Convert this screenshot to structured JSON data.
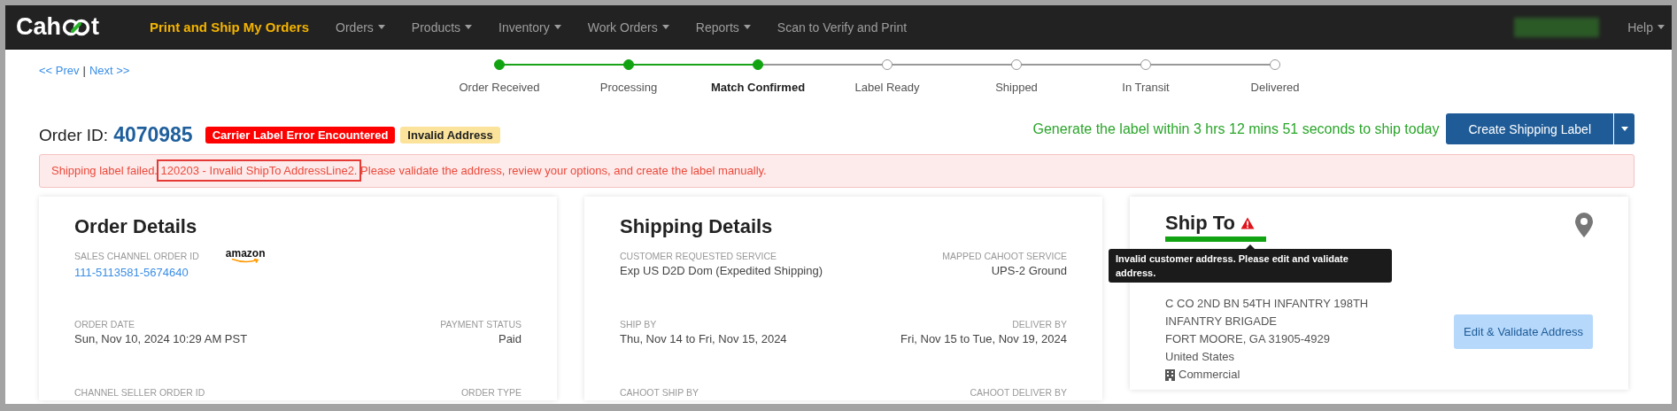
{
  "nav": {
    "logo": [
      "Cah",
      "t"
    ],
    "items": [
      {
        "label": "Print and Ship My Orders",
        "selected": true,
        "dropdown": false
      },
      {
        "label": "Orders",
        "selected": false,
        "dropdown": true
      },
      {
        "label": "Products",
        "selected": false,
        "dropdown": true
      },
      {
        "label": "Inventory",
        "selected": false,
        "dropdown": true
      },
      {
        "label": "Work Orders",
        "selected": false,
        "dropdown": true
      },
      {
        "label": "Reports",
        "selected": false,
        "dropdown": true
      },
      {
        "label": "Scan to Verify and Print",
        "selected": false,
        "dropdown": false
      }
    ],
    "help": {
      "label": "Help",
      "dropdown": true
    }
  },
  "pager": {
    "prev": "<< Prev",
    "separator": "|",
    "next": "Next >>"
  },
  "steps": [
    {
      "label": "Order Received",
      "done": true,
      "current": false
    },
    {
      "label": "Processing",
      "done": true,
      "current": false
    },
    {
      "label": "Match Confirmed",
      "done": true,
      "current": true
    },
    {
      "label": "Label Ready",
      "done": false,
      "current": false
    },
    {
      "label": "Shipped",
      "done": false,
      "current": false
    },
    {
      "label": "In Transit",
      "done": false,
      "current": false
    },
    {
      "label": "Delivered",
      "done": false,
      "current": false
    }
  ],
  "order": {
    "label": "Order ID:",
    "id": "4070985",
    "badges": [
      {
        "text": "Carrier Label Error Encountered",
        "kind": "error"
      },
      {
        "text": "Invalid Address",
        "kind": "warning"
      }
    ]
  },
  "ship_notice": "Generate the label within 3 hrs 12 mins 51 seconds to ship today",
  "create_button": {
    "label": "Create Shipping Label",
    "dropdown": true
  },
  "alert": {
    "before": "Shipping label failed.",
    "highlight": "120203 - Invalid ShipTo AddressLine2.",
    "after": "Please validate the address, review your options, and create the label manually."
  },
  "cards": [
    {
      "title": "Order Details",
      "rows": [
        {
          "left": {
            "label": "SALES CHANNEL ORDER ID",
            "value": "111-5113581-5674640",
            "link": true,
            "logo": "amazon"
          }
        },
        {
          "left": {
            "label": "ORDER DATE",
            "value": "Sun, Nov 10, 2024 10:29 AM PST"
          },
          "right": {
            "label": "PAYMENT STATUS",
            "value": "Paid"
          }
        },
        {
          "left": {
            "label": "CHANNEL SELLER ORDER ID"
          },
          "right": {
            "label": "ORDER TYPE"
          }
        }
      ]
    },
    {
      "title": "Shipping Details",
      "rows": [
        {
          "left": {
            "label": "CUSTOMER REQUESTED SERVICE",
            "value": "Exp US D2D Dom (Expedited Shipping)"
          },
          "right": {
            "label": "MAPPED CAHOOT SERVICE",
            "value": "UPS-2 Ground"
          }
        },
        {
          "left": {
            "label": "SHIP BY",
            "value": "Thu, Nov 14 to Fri, Nov 15, 2024"
          },
          "right": {
            "label": "DELIVER BY",
            "value": "Fri, Nov 15 to Tue, Nov 19, 2024"
          }
        },
        {
          "left": {
            "label": "CAHOOT SHIP BY"
          },
          "right": {
            "label": "CAHOOT DELIVER BY"
          }
        }
      ]
    }
  ],
  "ship_to": {
    "title": "Ship To",
    "warning": true,
    "tooltip": "Invalid customer address. Please edit and validate address.",
    "lines": [
      "C CO 2ND BN 54TH INFANTRY 198TH",
      "INFANTRY BRIGADE",
      "FORT MOORE, GA 31905-4929",
      "United States"
    ],
    "address_type": "Commercial",
    "button": "Edit & Validate Address"
  }
}
